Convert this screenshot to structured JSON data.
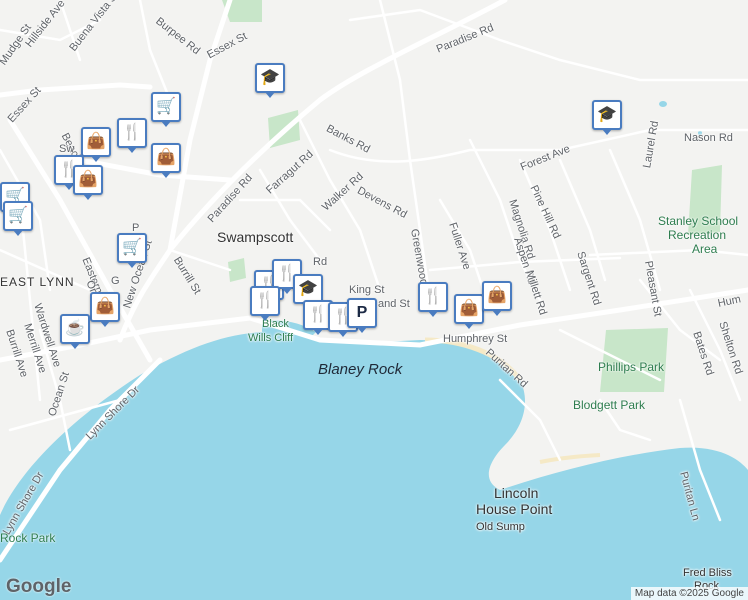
{
  "map": {
    "colors": {
      "water": "#96d6e8",
      "land": "#f3f3f1",
      "park": "#c8e6c9",
      "road": "#ffffff",
      "pin_border": "#4a7cc0"
    },
    "town_label": "Swampscott",
    "district_label": "EAST LYNN",
    "water_labels": {
      "rock": "Blaney Rock"
    },
    "point_label_1": "Lincoln",
    "point_label_2": "House Point",
    "small_labels": {
      "sump": "Old Sump",
      "cliff_1": "Black",
      "cliff_2": "Wills Cliff",
      "bliss_1": "Fred Bliss",
      "bliss_2": "Rock"
    },
    "parks": {
      "stanley_1": "Stanley School",
      "stanley_2": "Recreation",
      "stanley_3": "Area",
      "phillips": "Phillips Park",
      "blodgett": "Blodgett Park",
      "rock_park": "Rock Park"
    },
    "streets": {
      "hillside": "Hillside Ave",
      "buena": "Buena Vista St",
      "burpee": "Burpee Rd",
      "essex_top": "Essex St",
      "paradise_top": "Paradise Rd",
      "mudge": "Mudge St",
      "essex_left": "Essex St",
      "beach": "Beach",
      "banks": "Banks Rd",
      "farragut": "Farragut Rd",
      "walker": "Walker Rd",
      "devens": "Devens Rd",
      "paradise_mid": "Paradise Rd",
      "forest": "Forest Ave",
      "nason": "Nason Rd",
      "laurel": "Laurel Rd",
      "pine_hill": "Pine Hill Rd",
      "magnolia": "Magnolia Rd",
      "fuller": "Fuller Ave",
      "greenwood": "Greenwood",
      "aspen": "Aspen Rd",
      "sargent": "Sargent Rd",
      "millett": "Millett Rd",
      "pleasant": "Pleasant St",
      "humphrey_right": "Hum",
      "shelton": "Shelton Rd",
      "bates": "Bates Rd",
      "humphrey": "Humphrey St",
      "puritan": "Puritan Rd",
      "king": "King St",
      "land": "and St",
      "rd": "Rd",
      "burrill_st": "Burrill St",
      "new_ocean": "New Ocean St",
      "eastern": "Eastern A",
      "wardwell": "Wardwell Ave",
      "merrill": "Merrill Ave",
      "burrill_ave": "Burrill Ave",
      "ocean": "Ocean St",
      "lynn_shore": "Lynn Shore Dr",
      "lynn_shore_left": "Lynn Shore Dr",
      "puritan_ln": "Puritan Ln",
      "ocean_st_frag": "On",
      "sw": "Sw",
      "p": "P",
      "g": "G"
    },
    "pins": [
      {
        "icon": "cart-icon",
        "glyph": "🛒"
      },
      {
        "icon": "restaurant-icon",
        "glyph": "🍴"
      },
      {
        "icon": "shopping-bag-icon",
        "glyph": "👜"
      },
      {
        "icon": "shopping-bag-icon",
        "glyph": "👜"
      },
      {
        "icon": "restaurant-icon",
        "glyph": "🍴"
      },
      {
        "icon": "shopping-bag-icon",
        "glyph": "👜"
      },
      {
        "icon": "cart-icon",
        "glyph": "🛒"
      },
      {
        "icon": "cart-icon",
        "glyph": "🛒"
      },
      {
        "icon": "cart-icon",
        "glyph": "🛒"
      },
      {
        "icon": "shopping-bag-icon",
        "glyph": "👜"
      },
      {
        "icon": "coffee-icon",
        "glyph": "☕"
      },
      {
        "icon": "school-icon",
        "glyph": "🎓"
      },
      {
        "icon": "school-icon",
        "glyph": "🎓"
      },
      {
        "icon": "restaurant-icon",
        "glyph": "🍴"
      },
      {
        "icon": "restaurant-icon",
        "glyph": "🍴"
      },
      {
        "icon": "restaurant-icon",
        "glyph": "🍴"
      },
      {
        "icon": "school-icon",
        "glyph": "🎓"
      },
      {
        "icon": "restaurant-icon",
        "glyph": "🍴"
      },
      {
        "icon": "restaurant-icon",
        "glyph": "🍴"
      },
      {
        "icon": "parking-icon",
        "glyph": "P"
      },
      {
        "icon": "restaurant-icon",
        "glyph": "🍴"
      },
      {
        "icon": "shopping-bag-icon",
        "glyph": "👜"
      },
      {
        "icon": "shopping-bag-icon",
        "glyph": "👜"
      }
    ],
    "google_logo": "Google",
    "attribution": "Map data ©2025 Google"
  }
}
